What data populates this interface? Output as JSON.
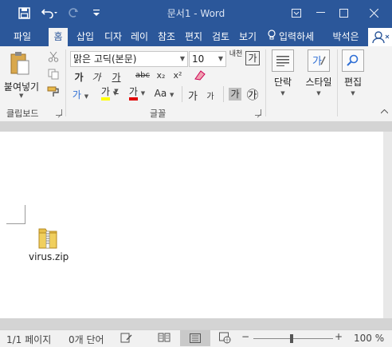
{
  "window": {
    "title": "문서1 - Word",
    "min": "—",
    "max": "☐",
    "close": "✕",
    "restore": "⧉"
  },
  "quick_access": {
    "save_icon": "save-icon",
    "undo_icon": "undo-icon",
    "redo_icon": "redo-icon",
    "customize_icon": "customize-icon"
  },
  "tabs": [
    {
      "label": "파일",
      "active": false
    },
    {
      "label": "홈",
      "active": true
    },
    {
      "label": "삽입",
      "active": false
    },
    {
      "label": "디자",
      "active": false
    },
    {
      "label": "레이",
      "active": false
    },
    {
      "label": "참조",
      "active": false
    },
    {
      "label": "편지",
      "active": false
    },
    {
      "label": "검토",
      "active": false
    },
    {
      "label": "보기",
      "active": false
    }
  ],
  "tell_me": "입력하세",
  "user_name": "박석은",
  "ribbon": {
    "clipboard": {
      "paste_label": "붙여넣기",
      "group_label": "클립보드"
    },
    "font": {
      "font_name": "맑은 고딕(본문)",
      "font_size": "10",
      "group_label": "글꼴",
      "bold": "가",
      "italic": "가",
      "underline": "가",
      "strike": "abc",
      "subscript": "x₂",
      "superscript": "x²",
      "text_effect": "가",
      "highlight": "가",
      "font_color": "가",
      "change_case": "Aa",
      "grow": "가",
      "shrink": "가",
      "char_shading": "가",
      "enclosed": "㉮",
      "phonetic": "내천",
      "char_border": "가"
    },
    "paragraph": {
      "label": "단락"
    },
    "styles": {
      "label": "스타일"
    },
    "editing": {
      "label": "편집"
    }
  },
  "document": {
    "file_label": "virus.zip"
  },
  "status": {
    "page": "1/1 페이지",
    "words": "0개 단어",
    "zoom_minus": "−",
    "zoom_plus": "+",
    "zoom_value": "100 %"
  },
  "colors": {
    "title_bg": "#2b579a",
    "ribbon_bg": "#f3f3f3",
    "highlight": "#ffff00",
    "font_red": "#e00000",
    "folder_yellow": "#e8c04a"
  }
}
